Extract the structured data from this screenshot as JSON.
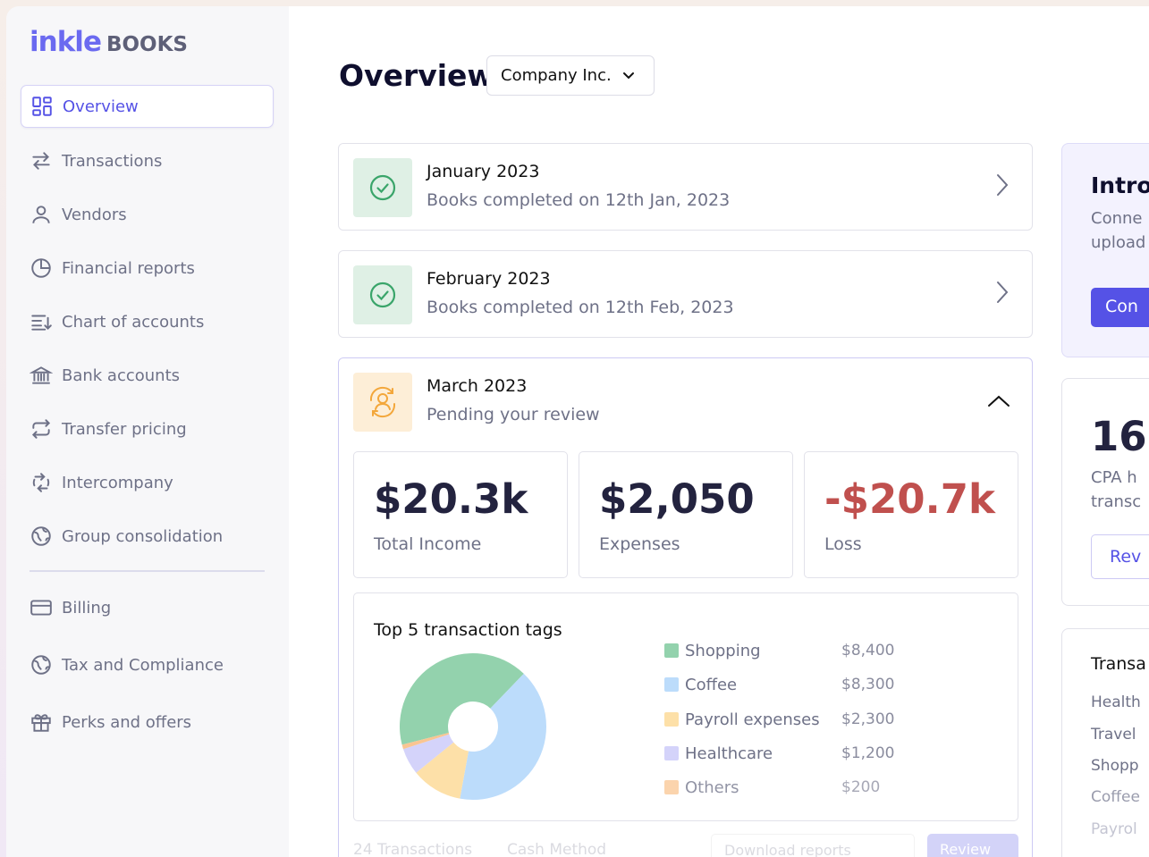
{
  "brand": {
    "logo_main": "inkle",
    "logo_sub": "BOOKS"
  },
  "sidebar": {
    "items": [
      {
        "label": "Overview",
        "icon": "grid-icon"
      },
      {
        "label": "Transactions",
        "icon": "arrows-swap-icon"
      },
      {
        "label": "Vendors",
        "icon": "user-icon"
      },
      {
        "label": "Financial reports",
        "icon": "pie-icon"
      },
      {
        "label": "Chart of accounts",
        "icon": "list-icon"
      },
      {
        "label": "Bank accounts",
        "icon": "bank-icon"
      },
      {
        "label": "Transfer pricing",
        "icon": "repeat-icon"
      },
      {
        "label": "Intercompany",
        "icon": "intercompany-icon"
      },
      {
        "label": "Group consolidation",
        "icon": "globe-icon"
      }
    ],
    "items_bottom": [
      {
        "label": "Billing",
        "icon": "card-icon"
      },
      {
        "label": "Tax and Compliance",
        "icon": "globe-icon"
      },
      {
        "label": "Perks and offers",
        "icon": "gift-icon"
      }
    ]
  },
  "header": {
    "title": "Overview",
    "company": "Company Inc."
  },
  "months": [
    {
      "name": "January 2023",
      "status": "Books completed on 12th Jan, 2023"
    },
    {
      "name": "February 2023",
      "status": "Books completed on 12th Feb, 2023"
    },
    {
      "name": "March 2023",
      "status": "Pending your review"
    }
  ],
  "stats": [
    {
      "value": "$20.3k",
      "label": "Total Income"
    },
    {
      "value": "$2,050",
      "label": "Expenses"
    },
    {
      "value": "-$20.7k",
      "label": "Loss"
    }
  ],
  "tags": {
    "title": "Top 5 transaction tags",
    "items": [
      {
        "name": "Shopping",
        "amount": "$8,400",
        "color": "#93d2ad"
      },
      {
        "name": "Coffee",
        "amount": "$8,300",
        "color": "#bcdcfb"
      },
      {
        "name": "Payroll expenses",
        "amount": "$2,300",
        "color": "#fde0a8"
      },
      {
        "name": "Healthcare",
        "amount": "$1,200",
        "color": "#d4d3fa"
      },
      {
        "name": "Others",
        "amount": "$200",
        "color": "#f9c592"
      }
    ]
  },
  "bottom_bar": {
    "transactions": "24 Transactions",
    "method": "Cash Method",
    "download": "Download reports",
    "review": "Review"
  },
  "right_panel": {
    "intro_title": "Intro",
    "intro_line1": "Conne",
    "intro_line2": "upload",
    "intro_button": "Con",
    "cpa_number": "16 .",
    "cpa_line1": "CPA h",
    "cpa_line2": "transc",
    "cpa_button": "Rev",
    "trans_title": "Transa",
    "trans_items": [
      "Health",
      "Travel",
      "Shopp",
      "Coffee",
      "Payrol"
    ]
  },
  "colors": {
    "accent": "#5552e6",
    "loss": "#c0504e",
    "success": "#3aa56a",
    "pending": "#f3a73b"
  }
}
